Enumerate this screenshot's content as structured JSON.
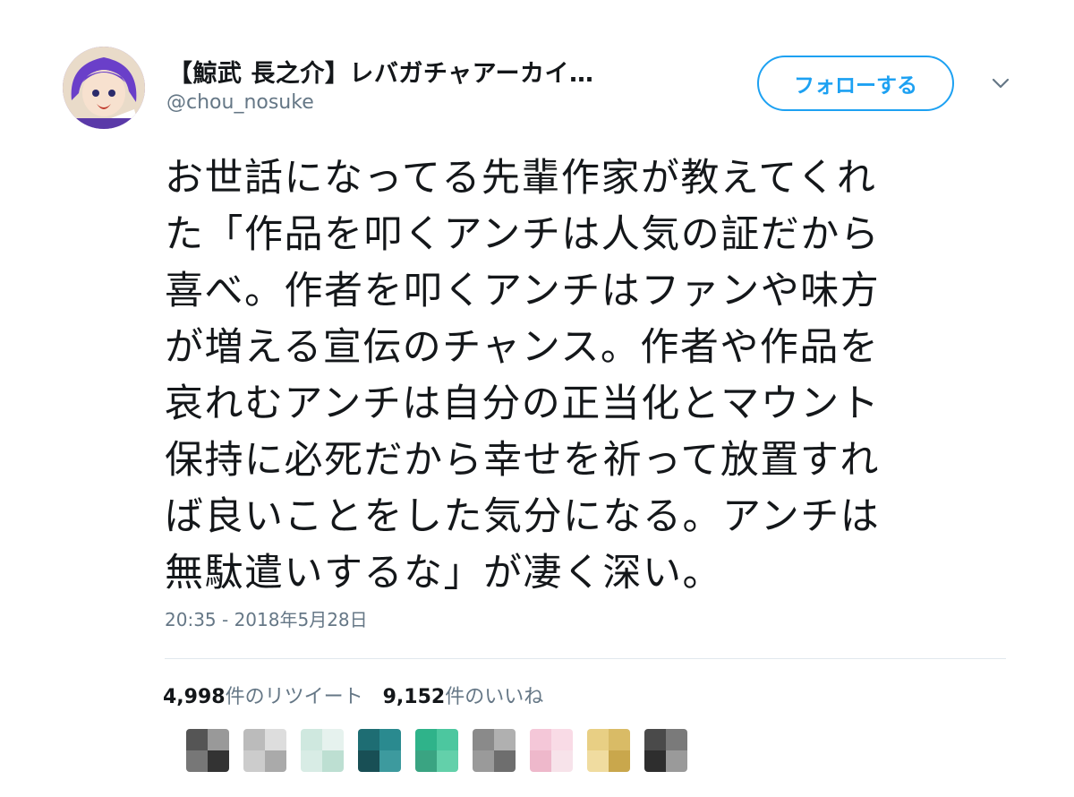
{
  "user": {
    "display_name": "【鯨武 長之介】レバガチャアーカイ…",
    "handle": "@chou_nosuke",
    "avatar_icon": "user-avatar-icon"
  },
  "follow_button": {
    "label": "フォローする",
    "color": "#1da1f2"
  },
  "menu": {
    "caret_icon": "chevron-down-icon"
  },
  "tweet": {
    "text_lines": [
      "お世話になってる先輩作家が教えてくれ",
      "た「作品を叩くアンチは人気の証だから",
      "喜べ。作者を叩くアンチはファンや味方",
      "が増える宣伝のチャンス。作者や作品を",
      "哀れむアンチは自分の正当化とマウント",
      "保持に必死だから幸せを祈って放置すれ",
      "ば良いことをした気分になる。アンチは",
      "無駄遣いするな」が凄く深い。"
    ],
    "timestamp": "20:35 - 2018年5月28日"
  },
  "stats": {
    "retweets_count": "4,998",
    "retweets_label": "件のリツイート",
    "likes_count": "9,152",
    "likes_label": "件のいいね"
  },
  "likers": [
    {
      "colors": [
        "#555555",
        "#999999",
        "#777777",
        "#333333"
      ]
    },
    {
      "colors": [
        "#bbbbbb",
        "#dddddd",
        "#cccccc",
        "#aaaaaa"
      ]
    },
    {
      "colors": [
        "#cfe8df",
        "#e6f2ee",
        "#d8ece5",
        "#bddfd2"
      ]
    },
    {
      "colors": [
        "#1e6d73",
        "#2a8a8f",
        "#184f55",
        "#3d9a9e"
      ]
    },
    {
      "colors": [
        "#2fb38a",
        "#4cc79f",
        "#3aa482",
        "#63d0aa"
      ]
    },
    {
      "colors": [
        "#8a8a8a",
        "#b0b0b0",
        "#9a9a9a",
        "#6e6e6e"
      ]
    },
    {
      "colors": [
        "#f4c7d8",
        "#f9dbe6",
        "#eeb8cb",
        "#f7e3ea"
      ]
    },
    {
      "colors": [
        "#e8cf84",
        "#d9bb66",
        "#f0dca0",
        "#c9a74c"
      ]
    },
    {
      "colors": [
        "#4a4a4a",
        "#7a7a7a",
        "#2e2e2e",
        "#9a9a9a"
      ]
    }
  ]
}
